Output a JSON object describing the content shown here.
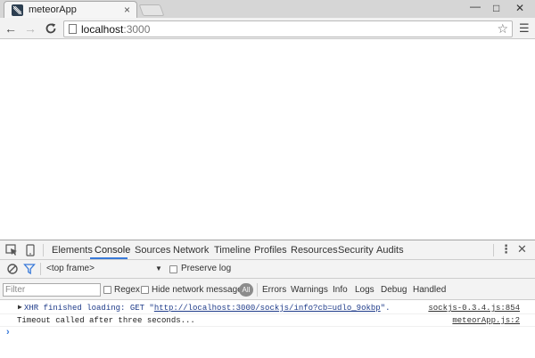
{
  "window": {
    "tab_title": "meteorApp",
    "tab_close": "×",
    "minimize": "—",
    "maximize": "□",
    "close": "✕"
  },
  "toolbar": {
    "back": "←",
    "forward": "→",
    "reload": "C",
    "url_host": "localhost",
    "url_port": ":3000",
    "star": "☆",
    "menu": "☰"
  },
  "devtools": {
    "tabs": [
      "Elements",
      "Console",
      "Sources",
      "Network",
      "Timeline",
      "Profiles",
      "Resources",
      "Security",
      "Audits"
    ],
    "active_tab": "Console",
    "more": "⋮",
    "close": "✕",
    "frame_select": "<top frame>",
    "frame_caret": "▼",
    "preserve_log": "Preserve log",
    "filter_placeholder": "Filter",
    "regex": "Regex",
    "hide_network": "Hide network messages",
    "level_all": "All",
    "levels": [
      "Errors",
      "Warnings",
      "Info",
      "Logs",
      "Debug",
      "Handled"
    ],
    "colors": {
      "accent": "#3879d9",
      "xhr_text": "#1f3c8a",
      "favicon_bg": "#2c3e50"
    }
  },
  "console": {
    "messages": [
      {
        "expander": "▶",
        "prefix": "XHR finished loading: GET \"",
        "link": "http://localhost:3000/sockjs/info?cb=udlo_9okbp",
        "suffix": "\".",
        "source": "sockjs-0.3.4.js:854"
      },
      {
        "text": "Timeout called after three seconds...",
        "source": "meteorApp.js:2"
      }
    ],
    "prompt": "›"
  }
}
